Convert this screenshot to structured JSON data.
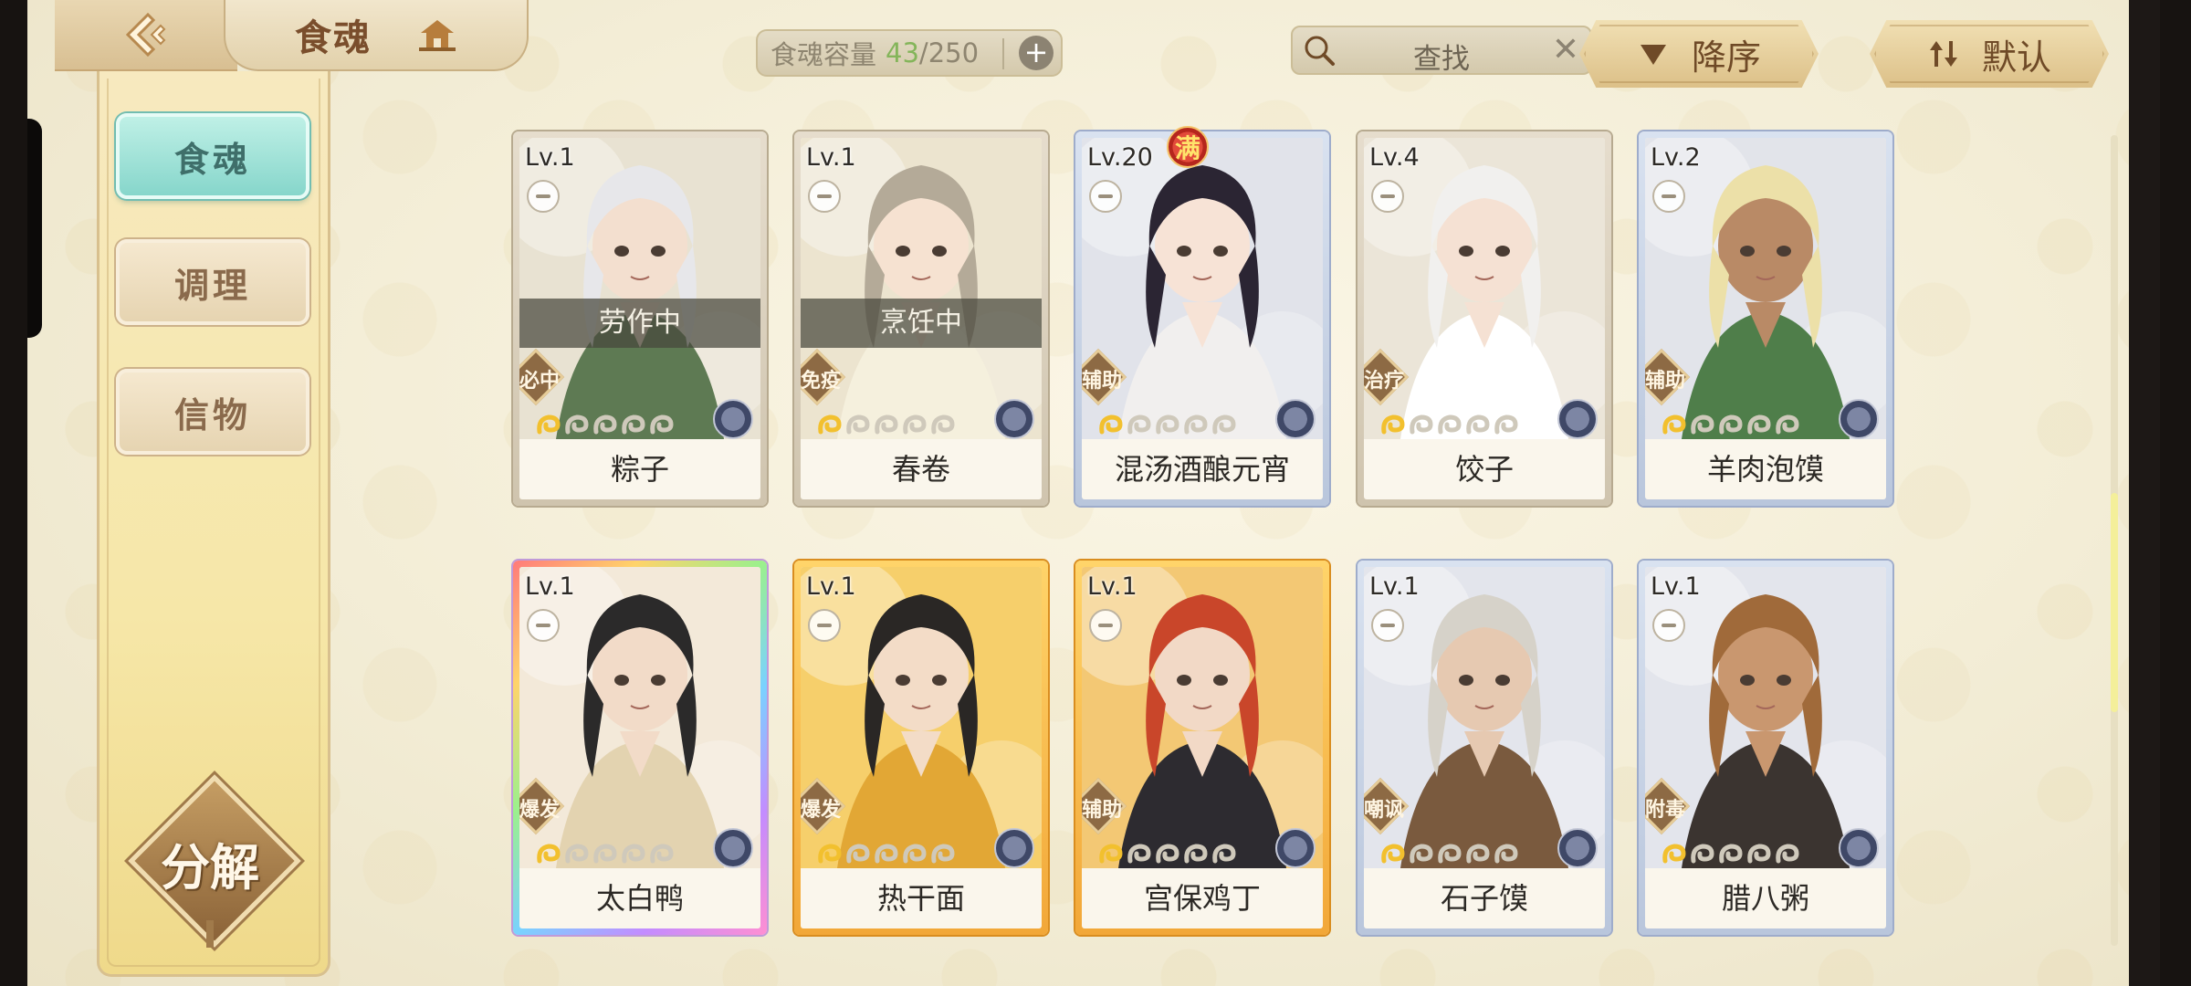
{
  "header": {
    "title": "食魂",
    "capacity_label": "食魂容量",
    "capacity_current": "43",
    "capacity_sep_total": "/250",
    "plus_icon": "+",
    "search_label": "查找",
    "search_clear": "✕",
    "sort_order": "降序",
    "sort_default": "默认"
  },
  "sidebar": {
    "items": [
      {
        "label": "食魂"
      },
      {
        "label": "调理"
      },
      {
        "label": "信物"
      }
    ],
    "decompose_label": "分解"
  },
  "cards": [
    {
      "level": "Lv.1",
      "name": "粽子",
      "role": "必中",
      "status": "劳作中",
      "frame": "silver",
      "art": {
        "hair": "#e7e7ea",
        "outfit": "#5e7a53",
        "bg": "#e8e2d2",
        "skin": "#f3dfcf"
      },
      "stars_lit": 1
    },
    {
      "level": "Lv.1",
      "name": "春卷",
      "role": "免疫",
      "status": "烹饪中",
      "frame": "silver",
      "art": {
        "hair": "#b4aa98",
        "outfit": "#f5f0dd",
        "bg": "#ece4cf",
        "skin": "#f6e2d1"
      },
      "stars_lit": 1
    },
    {
      "level": "Lv.20",
      "name": "混汤酒酿元宵",
      "role": "辅助",
      "status": "",
      "frame": "blue",
      "max_mark": "满",
      "art": {
        "hair": "#2b2533",
        "outfit": "#f1efee",
        "bg": "#e1e3ea",
        "skin": "#f7e3d6"
      },
      "stars_lit": 1
    },
    {
      "level": "Lv.4",
      "name": "饺子",
      "role": "治疗",
      "status": "",
      "frame": "silver",
      "art": {
        "hair": "#f1f0ee",
        "outfit": "#ffffff",
        "bg": "#ebe5d8",
        "skin": "#f5e1d3"
      },
      "stars_lit": 1
    },
    {
      "level": "Lv.2",
      "name": "羊肉泡馍",
      "role": "辅助",
      "status": "",
      "frame": "blue",
      "art": {
        "hair": "#ece0a8",
        "outfit": "#4f7e4a",
        "bg": "#e2e4ea",
        "skin": "#b98a66"
      },
      "stars_lit": 1
    },
    {
      "level": "Lv.1",
      "name": "太白鸭",
      "role": "爆发",
      "status": "",
      "frame": "rainbow",
      "art": {
        "hair": "#2b2a2a",
        "outfit": "#e3d3b0",
        "bg": "#f3e9d9",
        "skin": "#f2dbc8"
      },
      "stars_lit": 1
    },
    {
      "level": "Lv.1",
      "name": "热干面",
      "role": "爆发",
      "status": "",
      "frame": "gold",
      "art": {
        "hair": "#2a2725",
        "outfit": "#e2a735",
        "bg": "#f6cf6b",
        "skin": "#f3dcc7"
      },
      "stars_lit": 1
    },
    {
      "level": "Lv.1",
      "name": "宫保鸡丁",
      "role": "辅助",
      "status": "",
      "frame": "gold",
      "art": {
        "hair": "#c9462a",
        "outfit": "#2d2b30",
        "bg": "#f3c874",
        "skin": "#f2d9c6"
      },
      "stars_lit": 1
    },
    {
      "level": "Lv.1",
      "name": "石子馍",
      "role": "嘲讽",
      "status": "",
      "frame": "blue",
      "art": {
        "hair": "#d6d2c9",
        "outfit": "#7a5a3e",
        "bg": "#e3e5ec",
        "skin": "#e6c9b1"
      },
      "stars_lit": 1
    },
    {
      "level": "Lv.1",
      "name": "腊八粥",
      "role": "附毒",
      "status": "",
      "frame": "blue",
      "art": {
        "hair": "#a06a3a",
        "outfit": "#3b3430",
        "bg": "#e3e5ec",
        "skin": "#c9976f"
      },
      "stars_lit": 1
    }
  ],
  "colors": {
    "accent_teal": "#86d6cb",
    "capacity_green": "#84b55a",
    "card_frame_gold": "#f2a738",
    "card_frame_blue": "#b9c6dc"
  }
}
